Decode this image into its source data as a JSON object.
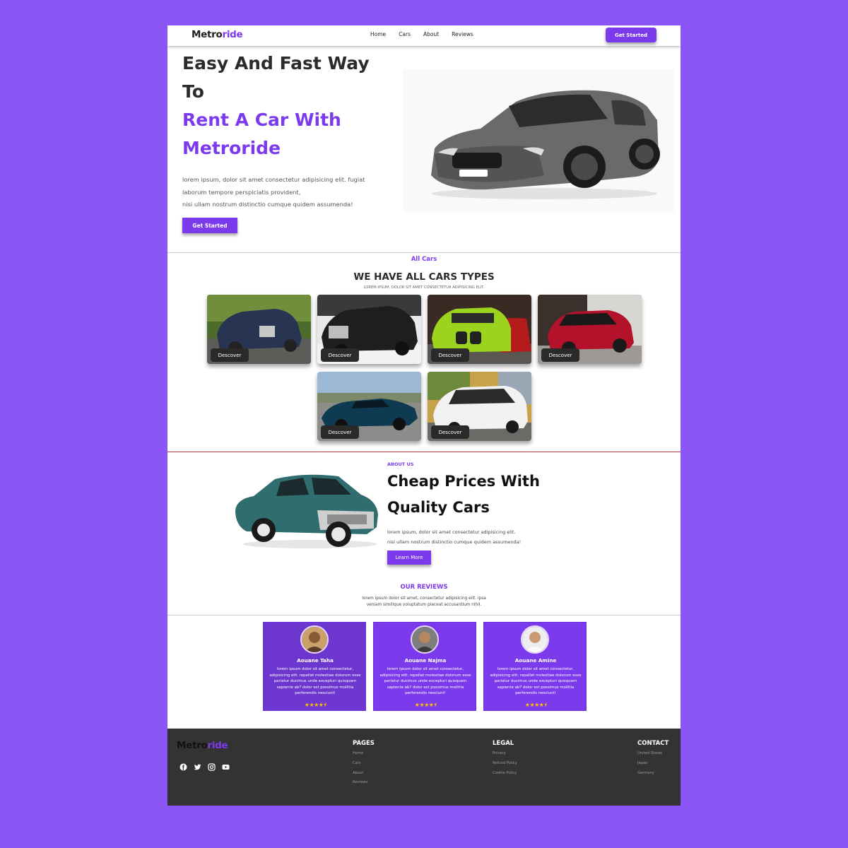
{
  "brand": {
    "part1": "Metro",
    "part2": "ride"
  },
  "nav": {
    "links": [
      "Home",
      "Cars",
      "About",
      "Reviews"
    ],
    "cta": "Get Started"
  },
  "hero": {
    "line1": "Easy And Fast Way",
    "line2": "To",
    "line3": "Rent A Car With",
    "line4": "Metroride",
    "para": [
      "lorem ipsum, dolor sit amet consectetur adipisicing elit. fugiat",
      "laborum tempore perspiciatis provident,",
      "nisi ullam nostrum distinctio cumque quidem assumenda!"
    ],
    "cta": "Get Started"
  },
  "cars": {
    "tag": "All Cars",
    "title": "WE HAVE ALL CARS TYPES",
    "subtitle": "LOREM IPSUM, DOLOR SIT AMET CONSECTETUR ADIPISICING ELIT.",
    "button_label": "Descover"
  },
  "about": {
    "tag": "ABOUT US",
    "title1": "Cheap Prices With",
    "title2": "Quality Cars",
    "para": [
      "lorem ipsum, dolor sit amet consectetur adipisicing elit.",
      "nisi ullam nostrum distinctio cumque quidem assumenda!"
    ],
    "cta": "Learn More"
  },
  "reviews": {
    "tag": "OUR REVIEWS",
    "sub": [
      "lorem ipsum dolor sit amet, consectetur adipisicing elit. ipsa",
      "veniam similique voluptatum placeat accusantium nihil."
    ],
    "items": [
      {
        "name": "Aouane Taha",
        "text": "lorem ipsum dolor sit amet consectetur, adipisicing elit. repellat molestiae dolorum esse pariatur ducimus unde excepturi quisquam sapiente ab? dolor est possimus mollitia perferendis nesciunt!",
        "stars": "★★★★⯨",
        "rating": 4.5
      },
      {
        "name": "Aouane Najma",
        "text": "lorem ipsum dolor sit amet consectetur, adipisicing elit. repellat molestiae dolorum esse pariatur ducimus unde excepturi quisquam sapiente ab? dolor est possimus mollitia perferendis nesciunt!",
        "stars": "★★★★⯨",
        "rating": 4.5
      },
      {
        "name": "Aouane Amine",
        "text": "lorem ipsum dolor sit amet consectetur, adipisicing elit. repellat molestiae dolorum esse pariatur ducimus unde excepturi quisquam sapiente ab? dolor est possimus mollitia perferendis nesciunt!",
        "stars": "★★★★⯨",
        "rating": 4.5
      }
    ]
  },
  "footer": {
    "social_icons": [
      "facebook-icon",
      "twitter-icon",
      "instagram-icon",
      "youtube-icon"
    ],
    "pages": {
      "title": "PAGES",
      "links": [
        "Home",
        "Cars",
        "About",
        "Reviews"
      ]
    },
    "legal": {
      "title": "LEGAL",
      "links": [
        "Privacy",
        "Refund Policy",
        "Cookie Policy"
      ]
    },
    "contact": {
      "title": "CONTACT",
      "links": [
        "United States",
        "Japan",
        "Germany"
      ]
    }
  },
  "colors": {
    "accent": "#7c3aed",
    "background": "#8b55f6",
    "footer": "#333333",
    "star": "#ffc400"
  }
}
